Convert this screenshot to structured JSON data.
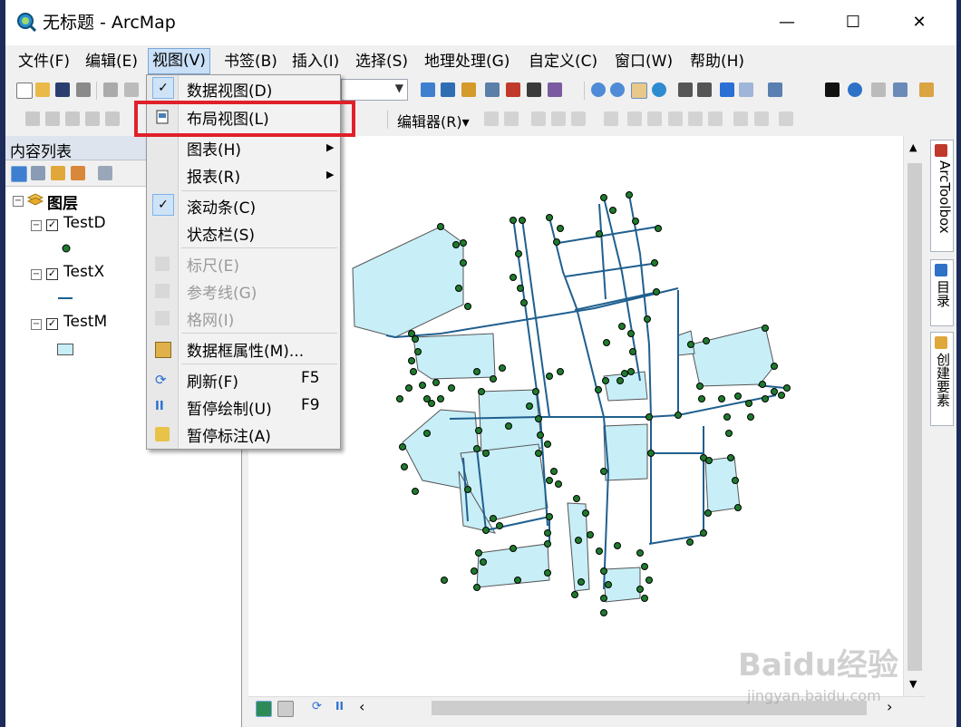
{
  "window": {
    "title": "无标题 - ArcMap",
    "controls": {
      "minimize": "—",
      "maximize": "☐",
      "close": "✕"
    }
  },
  "menubar": {
    "items": [
      "文件(F)",
      "编辑(E)",
      "视图(V)",
      "书签(B)",
      "插入(I)",
      "选择(S)",
      "地理处理(G)",
      "自定义(C)",
      "窗口(W)",
      "帮助(H)"
    ],
    "active_index": 2
  },
  "toolbar": {
    "editor_label": "编辑器(R)▾"
  },
  "toc": {
    "title": "内容列表",
    "root_label": "图层",
    "layers": [
      {
        "name": "TestD",
        "symbol": "point"
      },
      {
        "name": "TestX",
        "symbol": "line"
      },
      {
        "name": "TestM",
        "symbol": "polygon"
      }
    ]
  },
  "view_menu": {
    "items": [
      {
        "label": "数据视图(D)",
        "shortcut": "",
        "enabled": true,
        "checked": true,
        "submenu": false
      },
      {
        "label": "布局视图(L)",
        "shortcut": "",
        "enabled": true,
        "checked": false,
        "submenu": false,
        "highlighted": true
      },
      {
        "label": "图表(H)",
        "shortcut": "",
        "enabled": true,
        "checked": false,
        "submenu": true
      },
      {
        "label": "报表(R)",
        "shortcut": "",
        "enabled": true,
        "checked": false,
        "submenu": true
      },
      {
        "label": "滚动条(C)",
        "shortcut": "",
        "enabled": true,
        "checked": true,
        "submenu": false
      },
      {
        "label": "状态栏(S)",
        "shortcut": "",
        "enabled": true,
        "checked": false,
        "submenu": false
      },
      {
        "label": "标尺(E)",
        "shortcut": "",
        "enabled": false,
        "checked": false,
        "submenu": false
      },
      {
        "label": "参考线(G)",
        "shortcut": "",
        "enabled": false,
        "checked": false,
        "submenu": false
      },
      {
        "label": "格网(I)",
        "shortcut": "",
        "enabled": false,
        "checked": false,
        "submenu": false
      },
      {
        "label": "数据框属性(M)...",
        "shortcut": "",
        "enabled": true,
        "checked": false,
        "submenu": false
      },
      {
        "label": "刷新(F)",
        "shortcut": "F5",
        "enabled": true,
        "checked": false,
        "submenu": false
      },
      {
        "label": "暂停绘制(U)",
        "shortcut": "F9",
        "enabled": true,
        "checked": false,
        "submenu": false
      },
      {
        "label": "暂停标注(A)",
        "shortcut": "",
        "enabled": true,
        "checked": false,
        "submenu": false
      }
    ]
  },
  "right_panel": {
    "tabs": [
      "ArcToolbox",
      "目录",
      "创建要素"
    ]
  },
  "watermark": {
    "logo": "Baidu经验",
    "url": "jingyan.baidu.com"
  },
  "colors": {
    "polygon_fill": "#c8eef7",
    "line": "#1f5f8f",
    "point": "#1f7a2e",
    "highlight": "#e0202a",
    "menu_active": "#c9e0f7"
  }
}
